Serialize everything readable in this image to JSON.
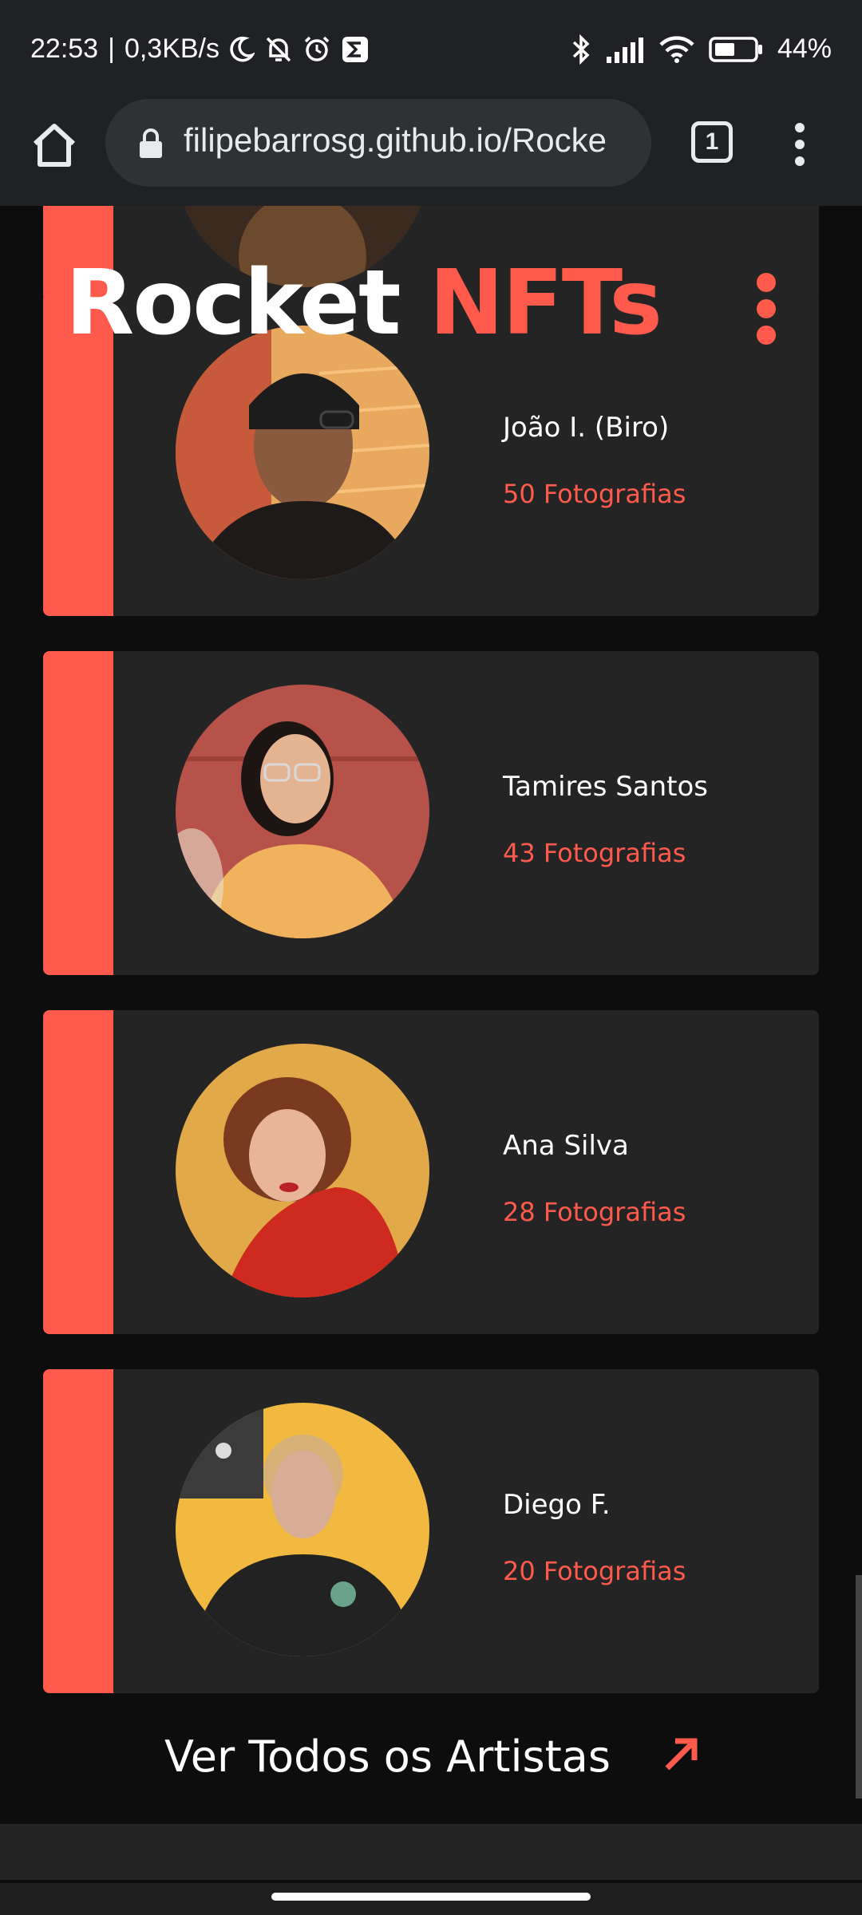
{
  "status_bar": {
    "time": "22:53",
    "speed": "0,3KB/s",
    "battery": "44%"
  },
  "browser": {
    "url": "filipebarrosg.github.io/Rocke",
    "tab_count": "1"
  },
  "brand": {
    "word1": "Rocket",
    "word2": "NFTs",
    "accent_color": "#ff5a4c"
  },
  "artists": [
    {
      "name": "João I. (Biro)",
      "photos": "50 Fotografias"
    },
    {
      "name": "Tamires Santos",
      "photos": "43 Fotografias"
    },
    {
      "name": "Ana Silva",
      "photos": "28 Fotografias"
    },
    {
      "name": "Diego F.",
      "photos": "20 Fotografias"
    }
  ],
  "cta": {
    "label": "Ver Todos os Artistas"
  }
}
